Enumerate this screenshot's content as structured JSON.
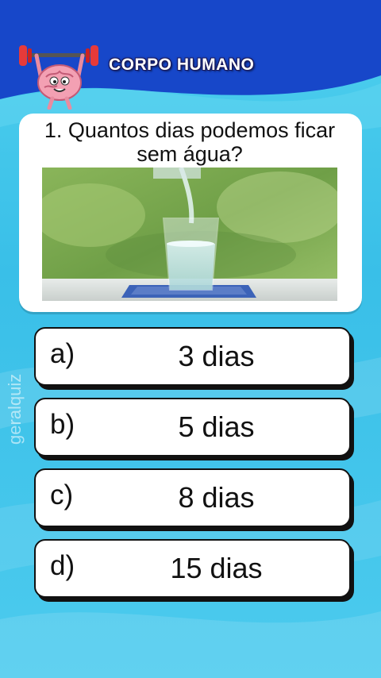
{
  "header": {
    "title": "CORPO HUMANO",
    "mascot_icon": "brain-weightlifter-icon"
  },
  "question": {
    "text": "1. Quantos dias podemos ficar sem água?",
    "image_icon": "water-glass-photo"
  },
  "answers": [
    {
      "letter": "a)",
      "text": "3 dias"
    },
    {
      "letter": "b)",
      "text": "5 dias"
    },
    {
      "letter": "c)",
      "text": "8 dias"
    },
    {
      "letter": "d)",
      "text": "15 dias"
    }
  ],
  "watermark": "geralquiz",
  "colors": {
    "header_blue": "#1747c9",
    "background_cyan": "#3fc4ea",
    "card": "#ffffff",
    "outline": "#111111"
  }
}
